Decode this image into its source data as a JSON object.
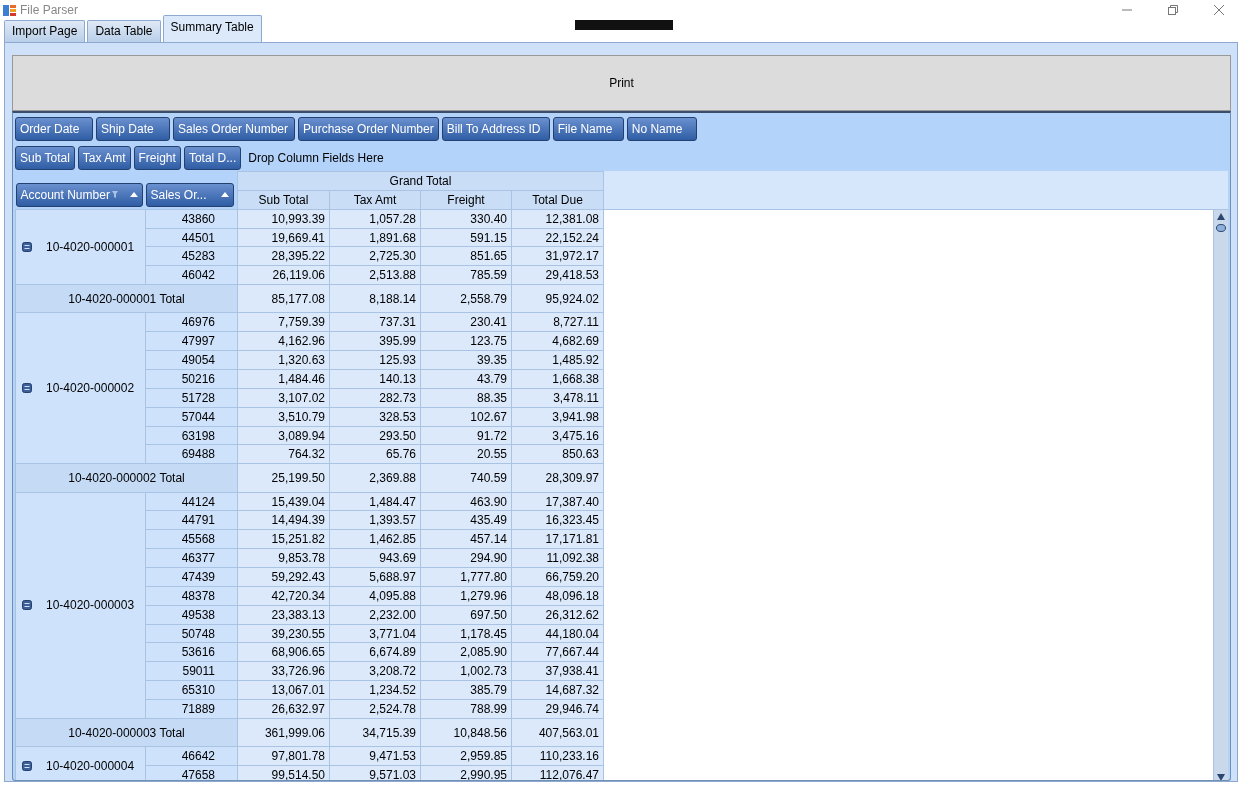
{
  "window": {
    "title": "File Parser"
  },
  "tabs": [
    {
      "label": "Import Page",
      "selected": false
    },
    {
      "label": "Data Table",
      "selected": false
    },
    {
      "label": "Summary Table",
      "selected": true
    }
  ],
  "print_button": "Print",
  "filter_fields": [
    "Order Date",
    "Ship Date",
    "Sales Order Number",
    "Purchase Order Number",
    "Bill To Address ID",
    "File Name",
    "No Name"
  ],
  "data_fields": [
    "Sub Total",
    "Tax Amt",
    "Freight",
    "Total D..."
  ],
  "column_drop_hint": "Drop Column Fields Here",
  "row_fields": [
    {
      "label": "Account Number",
      "filtered": true
    },
    {
      "label": "Sales Or...",
      "filtered": false
    }
  ],
  "table": {
    "column_group": "Grand Total",
    "columns": [
      "Sub Total",
      "Tax Amt",
      "Freight",
      "Total Due"
    ],
    "groups": [
      {
        "account": "10-4020-000001",
        "expanded": true,
        "rows": [
          {
            "order": "43860",
            "values": [
              "10,993.39",
              "1,057.28",
              "330.40",
              "12,381.08"
            ]
          },
          {
            "order": "44501",
            "values": [
              "19,669.41",
              "1,891.68",
              "591.15",
              "22,152.24"
            ]
          },
          {
            "order": "45283",
            "values": [
              "28,395.22",
              "2,725.30",
              "851.65",
              "31,972.17"
            ]
          },
          {
            "order": "46042",
            "values": [
              "26,119.06",
              "2,513.88",
              "785.59",
              "29,418.53"
            ]
          }
        ],
        "total": {
          "label": "10-4020-000001 Total",
          "values": [
            "85,177.08",
            "8,188.14",
            "2,558.79",
            "95,924.02"
          ]
        }
      },
      {
        "account": "10-4020-000002",
        "expanded": true,
        "rows": [
          {
            "order": "46976",
            "values": [
              "7,759.39",
              "737.31",
              "230.41",
              "8,727.11"
            ]
          },
          {
            "order": "47997",
            "values": [
              "4,162.96",
              "395.99",
              "123.75",
              "4,682.69"
            ]
          },
          {
            "order": "49054",
            "values": [
              "1,320.63",
              "125.93",
              "39.35",
              "1,485.92"
            ]
          },
          {
            "order": "50216",
            "values": [
              "1,484.46",
              "140.13",
              "43.79",
              "1,668.38"
            ]
          },
          {
            "order": "51728",
            "values": [
              "3,107.02",
              "282.73",
              "88.35",
              "3,478.11"
            ]
          },
          {
            "order": "57044",
            "values": [
              "3,510.79",
              "328.53",
              "102.67",
              "3,941.98"
            ]
          },
          {
            "order": "63198",
            "values": [
              "3,089.94",
              "293.50",
              "91.72",
              "3,475.16"
            ]
          },
          {
            "order": "69488",
            "values": [
              "764.32",
              "65.76",
              "20.55",
              "850.63"
            ]
          }
        ],
        "total": {
          "label": "10-4020-000002 Total",
          "values": [
            "25,199.50",
            "2,369.88",
            "740.59",
            "28,309.97"
          ]
        }
      },
      {
        "account": "10-4020-000003",
        "expanded": true,
        "rows": [
          {
            "order": "44124",
            "values": [
              "15,439.04",
              "1,484.47",
              "463.90",
              "17,387.40"
            ]
          },
          {
            "order": "44791",
            "values": [
              "14,494.39",
              "1,393.57",
              "435.49",
              "16,323.45"
            ]
          },
          {
            "order": "45568",
            "values": [
              "15,251.82",
              "1,462.85",
              "457.14",
              "17,171.81"
            ]
          },
          {
            "order": "46377",
            "values": [
              "9,853.78",
              "943.69",
              "294.90",
              "11,092.38"
            ]
          },
          {
            "order": "47439",
            "values": [
              "59,292.43",
              "5,688.97",
              "1,777.80",
              "66,759.20"
            ]
          },
          {
            "order": "48378",
            "values": [
              "42,720.34",
              "4,095.88",
              "1,279.96",
              "48,096.18"
            ]
          },
          {
            "order": "49538",
            "values": [
              "23,383.13",
              "2,232.00",
              "697.50",
              "26,312.62"
            ]
          },
          {
            "order": "50748",
            "values": [
              "39,230.55",
              "3,771.04",
              "1,178.45",
              "44,180.04"
            ]
          },
          {
            "order": "53616",
            "values": [
              "68,906.65",
              "6,674.89",
              "2,085.90",
              "77,667.44"
            ]
          },
          {
            "order": "59011",
            "values": [
              "33,726.96",
              "3,208.72",
              "1,002.73",
              "37,938.41"
            ]
          },
          {
            "order": "65310",
            "values": [
              "13,067.01",
              "1,234.52",
              "385.79",
              "14,687.32"
            ]
          },
          {
            "order": "71889",
            "values": [
              "26,632.97",
              "2,524.78",
              "788.99",
              "29,946.74"
            ]
          }
        ],
        "total": {
          "label": "10-4020-000003 Total",
          "values": [
            "361,999.06",
            "34,715.39",
            "10,848.56",
            "407,563.01"
          ]
        }
      },
      {
        "account": "10-4020-000004",
        "expanded": true,
        "rows": [
          {
            "order": "46642",
            "values": [
              "97,801.78",
              "9,471.53",
              "2,959.85",
              "110,233.16"
            ]
          },
          {
            "order": "47658",
            "values": [
              "99,514.50",
              "9,571.03",
              "2,990.95",
              "112,076.47"
            ]
          }
        ]
      }
    ]
  }
}
